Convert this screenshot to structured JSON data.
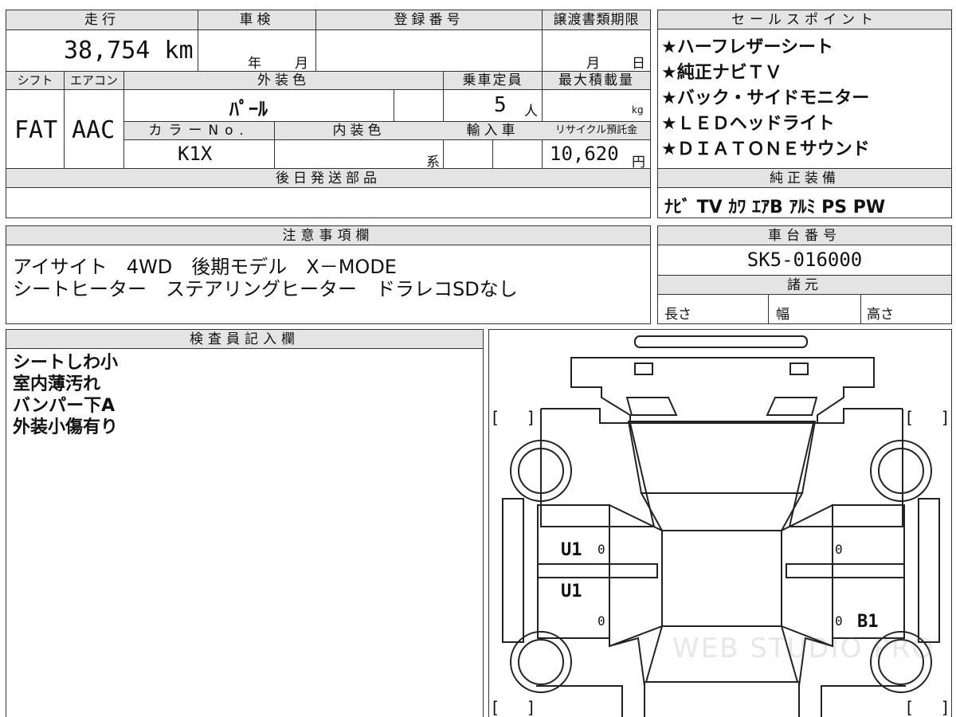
{
  "sheet": {
    "mileage_label": "走行",
    "mileage_value": "38,754 km",
    "inspection_label": "車検",
    "inspection_year_unit": "年",
    "inspection_month_unit": "月",
    "registration_label": "登録番号",
    "registration_value": "",
    "transfer_deadline_label": "譲渡書類期限",
    "transfer_month_unit": "月",
    "transfer_day_unit": "日",
    "shift_label": "シフト",
    "shift_value": "FAT",
    "aircon_label": "エアコン",
    "aircon_value": "AAC",
    "exterior_color_label": "外装色",
    "exterior_color_value": "ﾊﾟｰﾙ",
    "capacity_label": "乗車定員",
    "capacity_value": "5",
    "capacity_unit": "人",
    "max_load_label": "最大積載量",
    "max_load_unit": "kg",
    "color_no_label": "カラーNo.",
    "color_no_value": "K1X",
    "interior_color_label": "内装色",
    "interior_color_suffix": "系",
    "import_label": "輸入車",
    "recycle_label": "リサイクル預託金",
    "recycle_value": "10,620",
    "recycle_unit": "円",
    "later_parts_label": "後日発送部品"
  },
  "sales_points": {
    "title": "セールスポイント",
    "items": [
      "★ハーフレザーシート",
      "★純正ナビＴＶ",
      "★バック・サイドモニター",
      "★ＬＥＤヘッドライト",
      "★ＤＩＡＴＯＮＥサウンド"
    ]
  },
  "genuine_equipment": {
    "title": "純正装備",
    "value": "ﾅﾋﾞ TV ｶﾜ ｴｱB ｱﾙﾐ PS PW"
  },
  "notes": {
    "title": "注意事項欄",
    "lines": [
      "アイサイト　4WD　後期モデル　X－MODE",
      "シートヒーター　ステアリングヒーター　ドラレコSDなし"
    ]
  },
  "chassis": {
    "title": "車台番号",
    "value": "SK5-016000"
  },
  "specs": {
    "title": "諸元",
    "length_label": "長さ",
    "width_label": "幅",
    "height_label": "高さ"
  },
  "inspector": {
    "title": "検査員記入欄",
    "lines": [
      "シートしわ小",
      "室内薄汚れ",
      "バンパー下A",
      "外装小傷有り"
    ]
  },
  "diagram": {
    "marks": {
      "left_upper": "U1",
      "left_lower": "U1",
      "right_lower": "B1",
      "zero": "0",
      "bracket_open": "[",
      "bracket_close": "]"
    },
    "watermark": "WEB STUDIO PRO"
  }
}
